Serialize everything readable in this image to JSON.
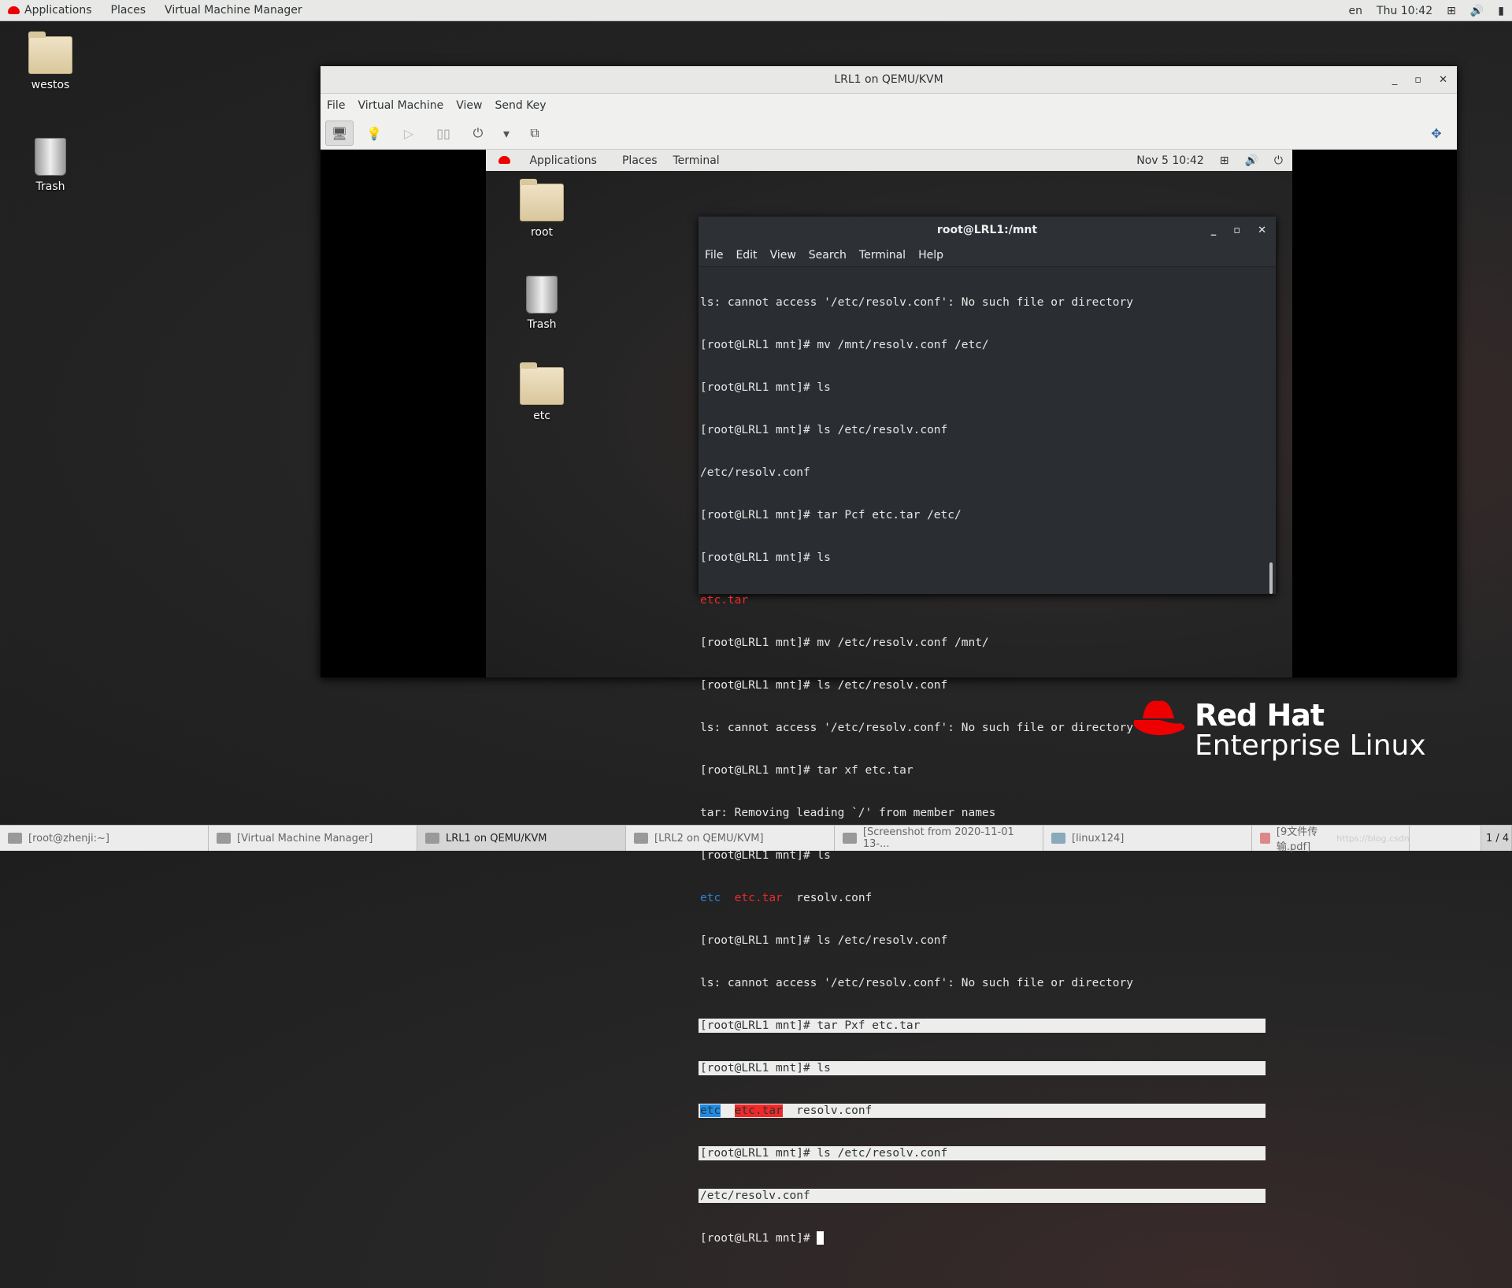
{
  "topbar": {
    "applications": "Applications",
    "places": "Places",
    "app": "Virtual Machine Manager",
    "lang": "en",
    "clock": "Thu 10:42"
  },
  "desktop": {
    "icons": [
      {
        "label": "westos"
      },
      {
        "label": "Trash"
      }
    ]
  },
  "vm": {
    "title": "LRL1 on QEMU/KVM",
    "menu": [
      "File",
      "Virtual Machine",
      "View",
      "Send Key"
    ],
    "guest": {
      "topbar": {
        "applications": "Applications",
        "places": "Places",
        "terminal": "Terminal",
        "clock": "Nov 5  10:42"
      },
      "icons": [
        {
          "label": "root"
        },
        {
          "label": "Trash"
        },
        {
          "label": "etc"
        }
      ],
      "terminal": {
        "title": "root@LRL1:/mnt",
        "menu": [
          "File",
          "Edit",
          "View",
          "Search",
          "Terminal",
          "Help"
        ],
        "lines": [
          "ls: cannot access '/etc/resolv.conf': No such file or directory",
          "[root@LRL1 mnt]# mv /mnt/resolv.conf /etc/",
          "[root@LRL1 mnt]# ls",
          "[root@LRL1 mnt]# ls /etc/resolv.conf",
          "/etc/resolv.conf",
          "[root@LRL1 mnt]# tar Pcf etc.tar /etc/",
          "[root@LRL1 mnt]# ls",
          "etc.tar",
          "[root@LRL1 mnt]# mv /etc/resolv.conf /mnt/",
          "[root@LRL1 mnt]# ls /etc/resolv.conf",
          "ls: cannot access '/etc/resolv.conf': No such file or directory",
          "[root@LRL1 mnt]# tar xf etc.tar",
          "tar: Removing leading `/' from member names",
          "[root@LRL1 mnt]# ls"
        ],
        "ls1": {
          "a": "etc",
          "b": "etc.tar",
          "c": "resolv.conf"
        },
        "lines2": [
          "[root@LRL1 mnt]# ls /etc/resolv.conf",
          "ls: cannot access '/etc/resolv.conf': No such file or directory"
        ],
        "sel_lines": [
          "[root@LRL1 mnt]# tar Pxf etc.tar",
          "[root@LRL1 mnt]# ls"
        ],
        "ls2": {
          "a": "etc",
          "b": "etc.tar",
          "c": "resolv.conf"
        },
        "sel_lines2": [
          "[root@LRL1 mnt]# ls /etc/resolv.conf",
          "/etc/resolv.conf"
        ],
        "prompt": "[root@LRL1 mnt]# "
      }
    }
  },
  "logo": {
    "line1": "Red Hat",
    "line2": "Enterprise Linux"
  },
  "taskbar": {
    "tasks": [
      "[root@zhenji:~]",
      "[Virtual Machine Manager]",
      "LRL1 on QEMU/KVM",
      "[LRL2 on QEMU/KVM]",
      "[Screenshot from 2020-11-01 13-...",
      "[linux124]",
      "[9文件传输.pdf]"
    ],
    "workspace": "1 / 4",
    "watermark": "https://blog.csdn.net/..."
  }
}
